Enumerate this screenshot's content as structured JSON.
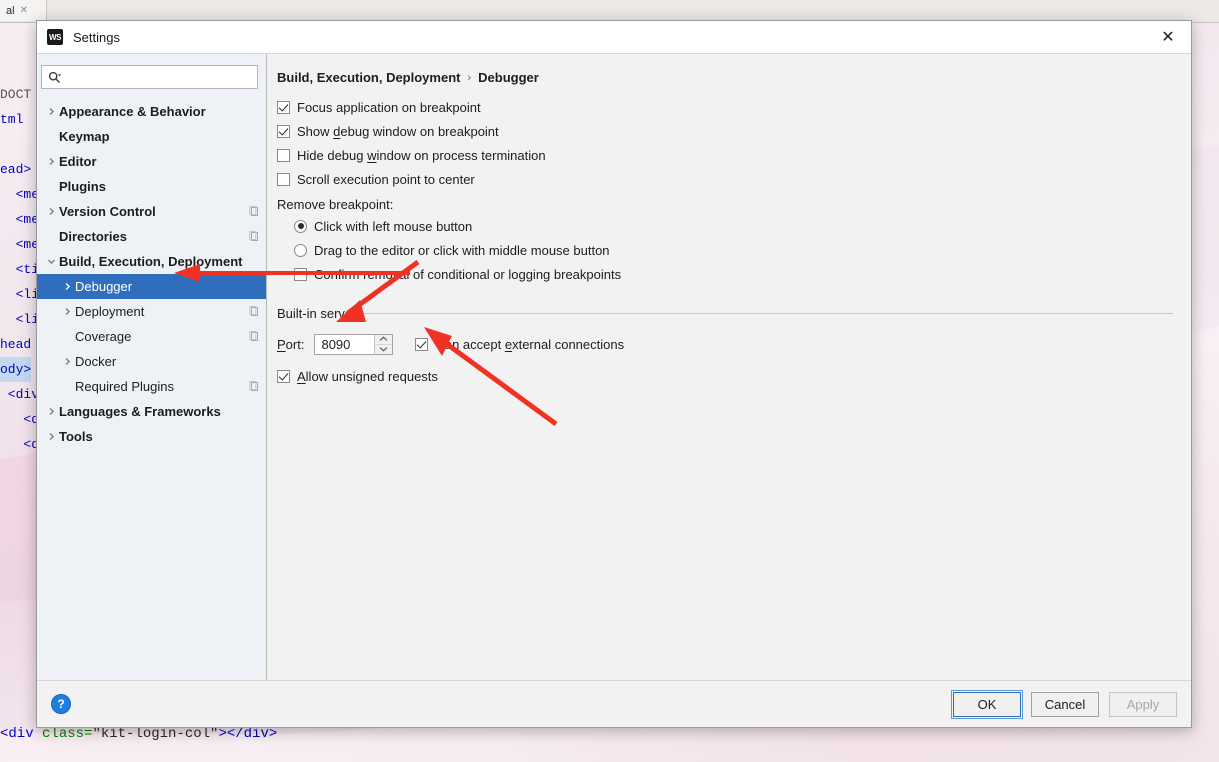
{
  "editor": {
    "tab_label": "al",
    "tab_close_icon": "close-icon",
    "code_lines": [
      "DOCT",
      "tml",
      "",
      "ead>",
      "  <met",
      "  <met",
      "  <met",
      "  <tit",
      "  <lin",
      "  <lin",
      "head",
      "ody>",
      " <div",
      "   <d",
      "   <d"
    ],
    "bottom_line": {
      "indent": "        ",
      "open_tag": "<div ",
      "attr_name": "class=",
      "attr_value": "\"kit-login-col\"",
      "close_bracket": ">",
      "close_tag": "</div>"
    }
  },
  "dialog": {
    "app_icon": "webstorm-icon",
    "app_icon_text": "WS",
    "title": "Settings",
    "close_icon": "close-icon"
  },
  "search": {
    "icon": "search-icon",
    "dropdown_icon": "chevron-down-icon",
    "value": "",
    "placeholder": ""
  },
  "sidebar": {
    "items": [
      {
        "label": "Appearance & Behavior",
        "chevron": "chevron-right-icon",
        "indent": 0,
        "bold": true,
        "selected": false,
        "badge": false
      },
      {
        "label": "Keymap",
        "chevron": "",
        "indent": 0,
        "bold": true,
        "selected": false,
        "badge": false
      },
      {
        "label": "Editor",
        "chevron": "chevron-right-icon",
        "indent": 0,
        "bold": true,
        "selected": false,
        "badge": false
      },
      {
        "label": "Plugins",
        "chevron": "",
        "indent": 0,
        "bold": true,
        "selected": false,
        "badge": false
      },
      {
        "label": "Version Control",
        "chevron": "chevron-right-icon",
        "indent": 0,
        "bold": true,
        "selected": false,
        "badge": true
      },
      {
        "label": "Directories",
        "chevron": "",
        "indent": 0,
        "bold": true,
        "selected": false,
        "badge": true
      },
      {
        "label": "Build, Execution, Deployment",
        "chevron": "chevron-down-icon",
        "indent": 0,
        "bold": true,
        "selected": false,
        "badge": false
      },
      {
        "label": "Debugger",
        "chevron": "chevron-right-icon",
        "indent": 1,
        "bold": false,
        "selected": true,
        "badge": false
      },
      {
        "label": "Deployment",
        "chevron": "chevron-right-icon",
        "indent": 1,
        "bold": false,
        "selected": false,
        "badge": true
      },
      {
        "label": "Coverage",
        "chevron": "",
        "indent": 1,
        "bold": false,
        "selected": false,
        "badge": true
      },
      {
        "label": "Docker",
        "chevron": "chevron-right-icon",
        "indent": 1,
        "bold": false,
        "selected": false,
        "badge": false
      },
      {
        "label": "Required Plugins",
        "chevron": "",
        "indent": 1,
        "bold": false,
        "selected": false,
        "badge": true
      },
      {
        "label": "Languages & Frameworks",
        "chevron": "chevron-right-icon",
        "indent": 0,
        "bold": true,
        "selected": false,
        "badge": false
      },
      {
        "label": "Tools",
        "chevron": "chevron-right-icon",
        "indent": 0,
        "bold": true,
        "selected": false,
        "badge": false
      }
    ]
  },
  "content": {
    "breadcrumb": {
      "root": "Build, Execution, Deployment",
      "separator": "›",
      "leaf": "Debugger"
    },
    "options": [
      {
        "label_before": "Focus application on breakpoint",
        "mnemonic": "",
        "label_after": "",
        "checked": true
      },
      {
        "label_before": "Show ",
        "mnemonic": "d",
        "label_after": "ebug window on breakpoint",
        "checked": true
      },
      {
        "label_before": "Hide debug ",
        "mnemonic": "w",
        "label_after": "indow on process termination",
        "checked": false
      },
      {
        "label_before": "Scroll execution point to center",
        "mnemonic": "",
        "label_after": "",
        "checked": false
      }
    ],
    "remove_breakpoint": {
      "label": "Remove breakpoint:",
      "radios": [
        {
          "label": "Click with left mouse button",
          "selected": true
        },
        {
          "label": "Drag to the editor or click with middle mouse button",
          "selected": false
        }
      ],
      "confirm_checkbox": {
        "label": "Confirm removal of conditional or logging breakpoints",
        "checked": false
      }
    },
    "builtin_server": {
      "section_title": "Built-in server",
      "port_label_mnemonic": "P",
      "port_label_rest": "ort:",
      "port_value": "8090",
      "stepper_up_icon": "chevron-up-icon",
      "stepper_down_icon": "chevron-down-icon",
      "external_checkbox": {
        "label_before": "Can accept ",
        "mnemonic": "e",
        "label_after": "xternal connections",
        "checked": true
      },
      "unsigned_checkbox": {
        "label_before": "",
        "mnemonic": "A",
        "label_after": "llow unsigned requests",
        "checked": true
      }
    }
  },
  "footer": {
    "help_icon": "help-icon",
    "help_label": "?",
    "buttons": [
      {
        "label": "OK",
        "style": "default"
      },
      {
        "label": "Cancel",
        "style": "normal"
      },
      {
        "label": "Apply",
        "style": "disabled"
      }
    ]
  },
  "annotations": {
    "arrow_color": "#f03225",
    "arrows": [
      {
        "name": "arrow-to-debugger",
        "target": "Debugger tree item"
      },
      {
        "name": "arrow-to-port-field",
        "target": "Port input"
      },
      {
        "name": "arrow-to-external-connections",
        "target": "Can accept external connections checkbox"
      }
    ]
  }
}
